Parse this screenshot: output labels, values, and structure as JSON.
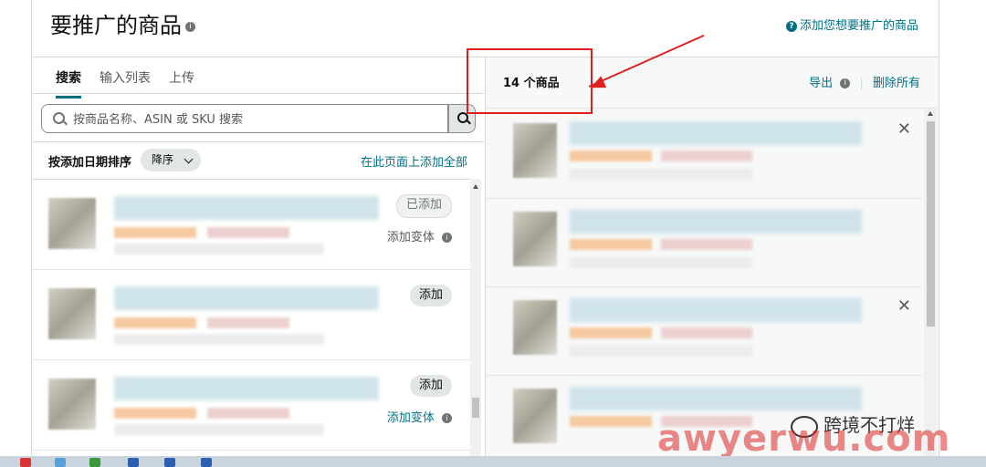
{
  "header": {
    "title": "要推广的商品",
    "help_link": "添加您想要推广的商品"
  },
  "left": {
    "tabs": [
      {
        "label": "搜索",
        "active": true
      },
      {
        "label": "输入列表",
        "active": false
      },
      {
        "label": "上传",
        "active": false
      }
    ],
    "search": {
      "placeholder": "按商品名称、ASIN 或 SKU 搜索",
      "value": ""
    },
    "sort": {
      "label": "按添加日期排序",
      "selected": "降序"
    },
    "add_all": "在此页面上添加全部",
    "rows": [
      {
        "button": "已添加",
        "variant": "添加变体"
      },
      {
        "button": "添加",
        "variant": ""
      },
      {
        "button": "添加",
        "variant": "添加变体"
      }
    ]
  },
  "right": {
    "count": "14 个商品",
    "export": "导出",
    "delete_all": "删除所有"
  },
  "watermark": {
    "text": "awyerwu.com",
    "wechat_label": "跨境不打烊"
  },
  "colors": {
    "link": "#007185",
    "highlight": "#e02020",
    "watermark": "#dc2828"
  }
}
